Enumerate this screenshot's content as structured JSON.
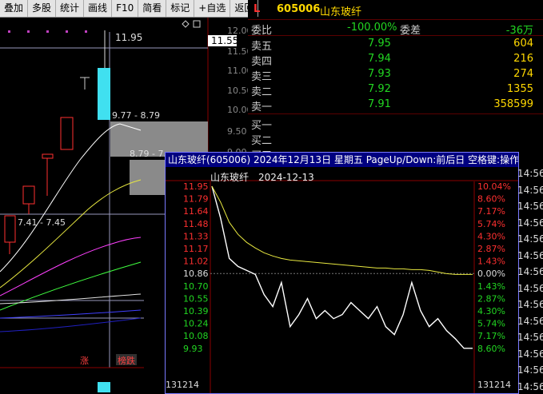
{
  "toolbar": {
    "items": [
      "叠加",
      "多股",
      "统计",
      "画线",
      "F10",
      "简看",
      "标记",
      "+自选",
      "返回"
    ]
  },
  "kchart": {
    "price_axis": [
      "12.00",
      "11.55",
      "11.50",
      "11.00",
      "10.50",
      "10.00",
      "9.50",
      "9.00"
    ],
    "high_label": "11.95",
    "range_labels": [
      "9.77 - 8.79",
      "8.79 - 7.",
      "7.41 - 7.45"
    ],
    "markers": {
      "zhang": "涨",
      "bangdie": "榜跌"
    },
    "current_price": "11.55"
  },
  "quote": {
    "flag": "L",
    "code": "605006",
    "name": "山东玻纤",
    "weibi_label": "委比",
    "weibi_value": "-100.00%",
    "weicha_label": "委差",
    "weicha_value": "-36万",
    "sells": [
      {
        "label": "卖五",
        "price": "7.95",
        "vol": "604"
      },
      {
        "label": "卖四",
        "price": "7.94",
        "vol": "216"
      },
      {
        "label": "卖三",
        "price": "7.93",
        "vol": "274"
      },
      {
        "label": "卖二",
        "price": "7.92",
        "vol": "1355"
      },
      {
        "label": "卖一",
        "price": "7.91",
        "vol": "358599"
      }
    ],
    "buys": [
      {
        "label": "买一"
      },
      {
        "label": "买二"
      },
      {
        "label": "买三"
      }
    ]
  },
  "minute_window": {
    "title": "山东玻纤(605006) 2024年12月13日 星期五 PageUp/Down:前后日 空格键:操作",
    "stock_name": "山东玻纤",
    "date": "2024-12-13",
    "volume_label": "131214",
    "left_prices": [
      "11.95",
      "11.79",
      "11.64",
      "11.48",
      "11.33",
      "11.17",
      "11.02",
      "10.86",
      "10.70",
      "10.55",
      "10.39",
      "10.24",
      "10.08",
      "9.93"
    ],
    "right_pcts": [
      "10.04%",
      "8.60%",
      "7.17%",
      "5.74%",
      "4.30%",
      "2.87%",
      "1.43%",
      "0.00%",
      "1.43%",
      "2.87%",
      "4.30%",
      "5.74%",
      "7.17%",
      "8.60%"
    ]
  },
  "time_column": [
    "14:56",
    "14:56",
    "14:56",
    "14:56",
    "14:56",
    "14:56",
    "14:56",
    "14:56",
    "14:56",
    "14:56",
    "14:56",
    "14:56",
    "14:56",
    "14:56"
  ],
  "chart_data": {
    "type": "line",
    "title": "",
    "xlabel": "",
    "ylabel": "",
    "ylim": [
      9.93,
      11.95
    ],
    "series": [
      {
        "name": "",
        "values": [
          11.95,
          11.55,
          11.05,
          10.95,
          10.9,
          10.85,
          10.6,
          10.45,
          10.75,
          10.2,
          10.35,
          10.55,
          10.3,
          10.4,
          10.3,
          10.35,
          10.5,
          10.4,
          10.3,
          10.45,
          10.2,
          10.1,
          10.35,
          10.75,
          10.4,
          10.2,
          10.3,
          10.15,
          10.05,
          9.93,
          9.93
        ]
      },
      {
        "name": "",
        "values": [
          11.95,
          11.75,
          11.5,
          11.35,
          11.25,
          11.18,
          11.12,
          11.08,
          11.05,
          11.03,
          11.02,
          11.01,
          11.0,
          10.99,
          10.98,
          10.97,
          10.96,
          10.95,
          10.94,
          10.93,
          10.93,
          10.92,
          10.92,
          10.91,
          10.91,
          10.9,
          10.88,
          10.86,
          10.85,
          10.85,
          10.85
        ]
      }
    ]
  }
}
